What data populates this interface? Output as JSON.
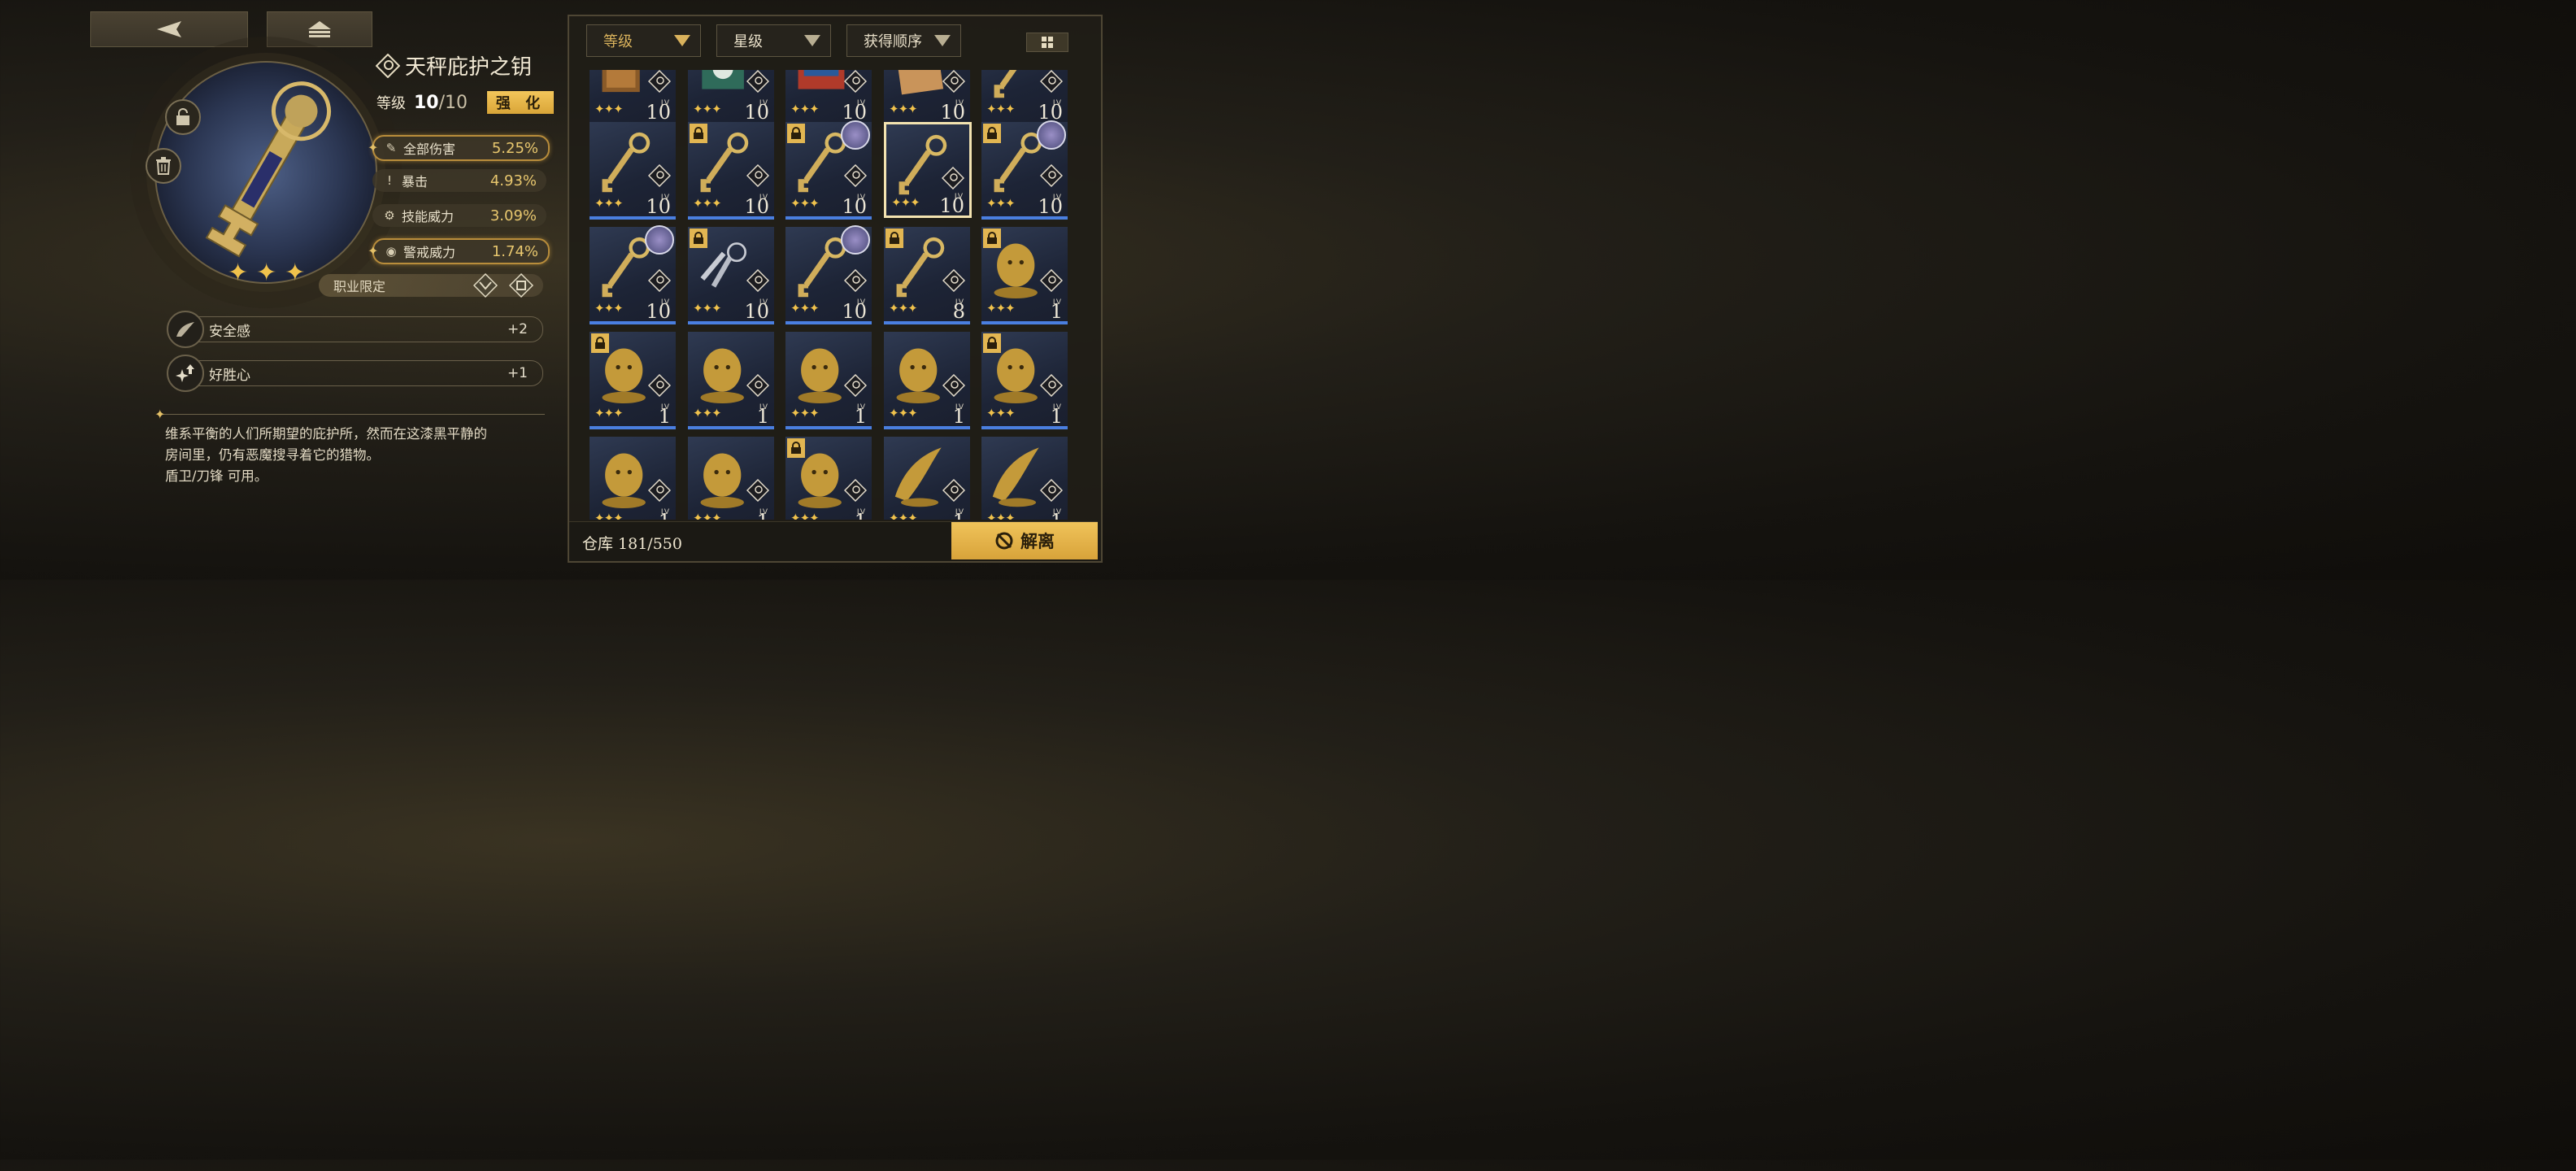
{
  "item": {
    "name": "天秤庇护之钥",
    "level_label": "等级",
    "level": "10",
    "level_max": "/10",
    "upgrade_label": "强 化",
    "stars": 3,
    "job_label": "职业限定",
    "description_lines": [
      "维系平衡的人们所期望的庇护所，然而在这漆黑平静的",
      "房间里，仍有恶魔搜寻着它的猎物。",
      "盾卫/刀锋 可用。"
    ]
  },
  "stats": [
    {
      "name": "全部伤害",
      "value": "5.25%",
      "highlight": true,
      "icon": "feather-icon"
    },
    {
      "name": "暴击",
      "value": "4.93%",
      "highlight": false,
      "icon": "crit-icon"
    },
    {
      "name": "技能威力",
      "value": "3.09%",
      "highlight": false,
      "icon": "gear-icon"
    },
    {
      "name": "警戒威力",
      "value": "1.74%",
      "highlight": true,
      "icon": "eye-icon"
    }
  ],
  "traits": [
    {
      "name": "安全感",
      "value": "+2",
      "icon": "wings-icon"
    },
    {
      "name": "好胜心",
      "value": "+1",
      "icon": "sparkle-up-icon"
    }
  ],
  "filters": [
    {
      "label": "等级",
      "color": "#d9b25c"
    },
    {
      "label": "星级",
      "color": "#e8e0c8"
    },
    {
      "label": "获得顺序",
      "color": "#e8e0c8"
    }
  ],
  "inventory": {
    "storage_label": "仓库 181/550",
    "dismantle_label": "解离",
    "lv_tag": "LV",
    "rows": [
      [
        {
          "lv": "10",
          "stars": 3,
          "lock": false,
          "avatar": false,
          "art": "book"
        },
        {
          "lv": "10",
          "stars": 3,
          "lock": false,
          "avatar": false,
          "art": "box"
        },
        {
          "lv": "10",
          "stars": 3,
          "lock": false,
          "avatar": false,
          "art": "device"
        },
        {
          "lv": "10",
          "stars": 3,
          "lock": false,
          "avatar": false,
          "art": "paper"
        },
        {
          "lv": "10",
          "stars": 3,
          "lock": false,
          "avatar": false,
          "art": "key"
        }
      ],
      [
        {
          "lv": "10",
          "stars": 3,
          "lock": false,
          "avatar": false,
          "art": "key"
        },
        {
          "lv": "10",
          "stars": 3,
          "lock": true,
          "avatar": false,
          "art": "key"
        },
        {
          "lv": "10",
          "stars": 3,
          "lock": true,
          "avatar": true,
          "art": "key"
        },
        {
          "lv": "10",
          "stars": 3,
          "lock": false,
          "avatar": false,
          "art": "key",
          "selected": true
        },
        {
          "lv": "10",
          "stars": 3,
          "lock": true,
          "avatar": true,
          "art": "key"
        }
      ],
      [
        {
          "lv": "10",
          "stars": 3,
          "lock": false,
          "avatar": true,
          "art": "key"
        },
        {
          "lv": "10",
          "stars": 3,
          "lock": true,
          "avatar": false,
          "art": "keys"
        },
        {
          "lv": "10",
          "stars": 3,
          "lock": false,
          "avatar": true,
          "art": "key"
        },
        {
          "lv": "8",
          "stars": 3,
          "lock": true,
          "avatar": false,
          "art": "key"
        },
        {
          "lv": "1",
          "stars": 3,
          "lock": true,
          "avatar": false,
          "art": "bust"
        }
      ],
      [
        {
          "lv": "1",
          "stars": 3,
          "lock": true,
          "avatar": false,
          "art": "bust"
        },
        {
          "lv": "1",
          "stars": 3,
          "lock": false,
          "avatar": false,
          "art": "bust"
        },
        {
          "lv": "1",
          "stars": 3,
          "lock": false,
          "avatar": false,
          "art": "bust"
        },
        {
          "lv": "1",
          "stars": 3,
          "lock": false,
          "avatar": false,
          "art": "bust"
        },
        {
          "lv": "1",
          "stars": 3,
          "lock": true,
          "avatar": false,
          "art": "bust"
        }
      ],
      [
        {
          "lv": "1",
          "stars": 3,
          "lock": false,
          "avatar": false,
          "art": "bust"
        },
        {
          "lv": "1",
          "stars": 3,
          "lock": false,
          "avatar": false,
          "art": "bust"
        },
        {
          "lv": "1",
          "stars": 3,
          "lock": true,
          "avatar": false,
          "art": "bust"
        },
        {
          "lv": "1",
          "stars": 3,
          "lock": false,
          "avatar": false,
          "art": "wing"
        },
        {
          "lv": "1",
          "stars": 3,
          "lock": false,
          "avatar": false,
          "art": "wing"
        }
      ]
    ]
  },
  "colors": {
    "accent": "#e0b34f",
    "bar_blue": "#4a7fe0",
    "panel": "#201d17"
  }
}
